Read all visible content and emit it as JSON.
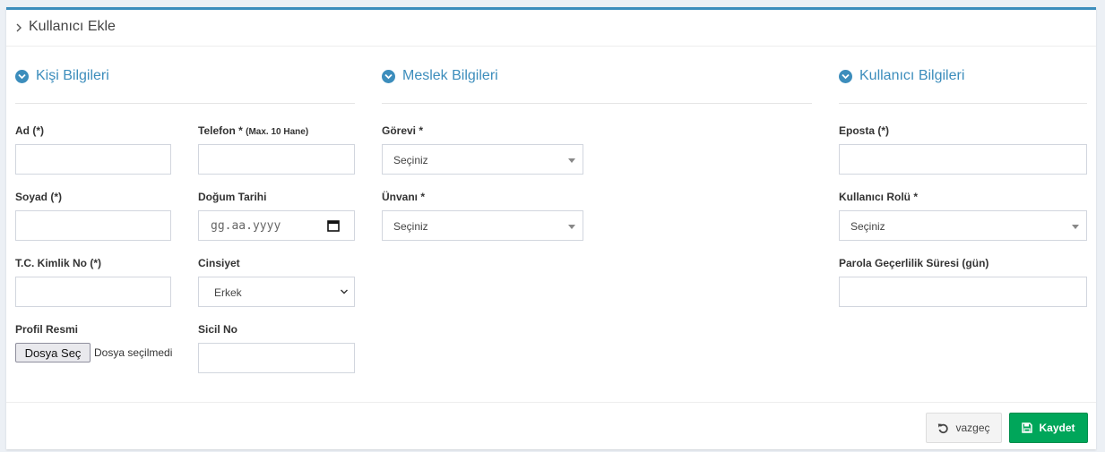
{
  "panel": {
    "title": "Kullanıcı Ekle"
  },
  "sections": {
    "personal": "Kişi Bilgileri",
    "job": "Meslek Bilgileri",
    "user": "Kullanıcı Bilgileri"
  },
  "fields": {
    "ad": {
      "label": "Ad (*)",
      "value": ""
    },
    "telefon": {
      "label": "Telefon *",
      "note": "(Max. 10 Hane)",
      "value": ""
    },
    "soyad": {
      "label": "Soyad (*)",
      "value": ""
    },
    "dogum_tarihi": {
      "label": "Doğum Tarihi",
      "placeholder": "gg.aa.yyyy"
    },
    "tc": {
      "label": "T.C. Kimlik No (*)",
      "value": ""
    },
    "cinsiyet": {
      "label": "Cinsiyet",
      "selected": "Erkek"
    },
    "profil": {
      "label": "Profil Resmi",
      "button": "Dosya Seç",
      "status": "Dosya seçilmedi"
    },
    "sicil": {
      "label": "Sicil No",
      "value": ""
    },
    "gorevi": {
      "label": "Görevi *",
      "selected": "Seçiniz"
    },
    "unvani": {
      "label": "Ünvanı *",
      "selected": "Seçiniz"
    },
    "eposta": {
      "label": "Eposta (*)",
      "value": ""
    },
    "rol": {
      "label": "Kullanıcı Rolü *",
      "selected": "Seçiniz"
    },
    "parola": {
      "label": "Parola Geçerlilik Süresi (gün)",
      "value": ""
    }
  },
  "buttons": {
    "cancel": "vazgeç",
    "save": "Kaydet"
  },
  "colors": {
    "accent": "#3c8dbc",
    "success": "#00a65a"
  },
  "icons": {
    "header": "chevron-right-icon",
    "section": "chevron-circle-down-icon",
    "date": "calendar-icon",
    "cancel": "undo-icon",
    "save": "floppy-disk-icon"
  }
}
